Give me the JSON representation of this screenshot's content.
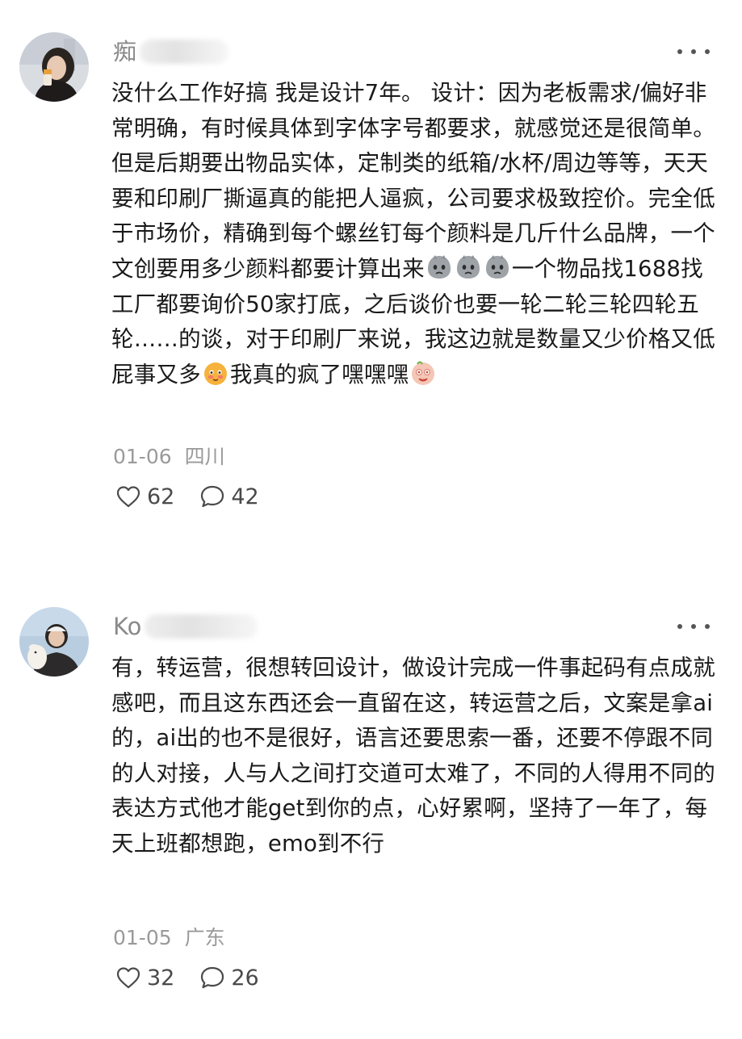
{
  "comments": [
    {
      "username_visible": "痴",
      "more_label": "···",
      "body_parts": [
        "没什么工作好搞 我是设计7年。 设计：因为老板需求/偏好非常明确，有时候具体到字体字号都要求，就感觉还是很简单。 但是后期要出物品实体，定制类的纸箱/水杯/周边等等，天天要和印刷厂撕逼真的能把人逼疯，公司要求极致控价。完全低于市场价，精确到每个螺丝钉每个颜料是几斤什么品牌，一个文创要用多少颜料都要计算出来",
        "一个物品找1688找工厂都要询价50家打底，之后谈价也要一轮二轮三轮四轮五轮……的谈，对于印刷厂来说，我这边就是数量又少价格又低屁事又多",
        "我真的疯了嘿嘿嘿"
      ],
      "emojis": [
        "sad-face-icon",
        "sad-face-icon",
        "sad-face-icon",
        "shy-face-icon",
        "crazy-face-icon"
      ],
      "date": "01-06",
      "location": "四川",
      "likes": "62",
      "replies": "42"
    },
    {
      "username_visible": "Ko",
      "more_label": "···",
      "body": "有，转运营，很想转回设计，做设计完成一件事起码有点成就感吧，而且这东西还会一直留在这，转运营之后，文案是拿ai的，ai出的也不是很好，语言还要思索一番，还要不停跟不同的人对接，人与人之间打交道可太难了，不同的人得用不同的表达方式他才能get到你的点，心好累啊，坚持了一年了，每天上班都想跑，emo到不行",
      "date": "01-05",
      "location": "广东",
      "likes": "32",
      "replies": "26"
    }
  ],
  "colors": {
    "text": "#1a1a1a",
    "meta": "#9a9a9a",
    "username": "#8a8a8a",
    "icon": "#4a4a4a"
  }
}
